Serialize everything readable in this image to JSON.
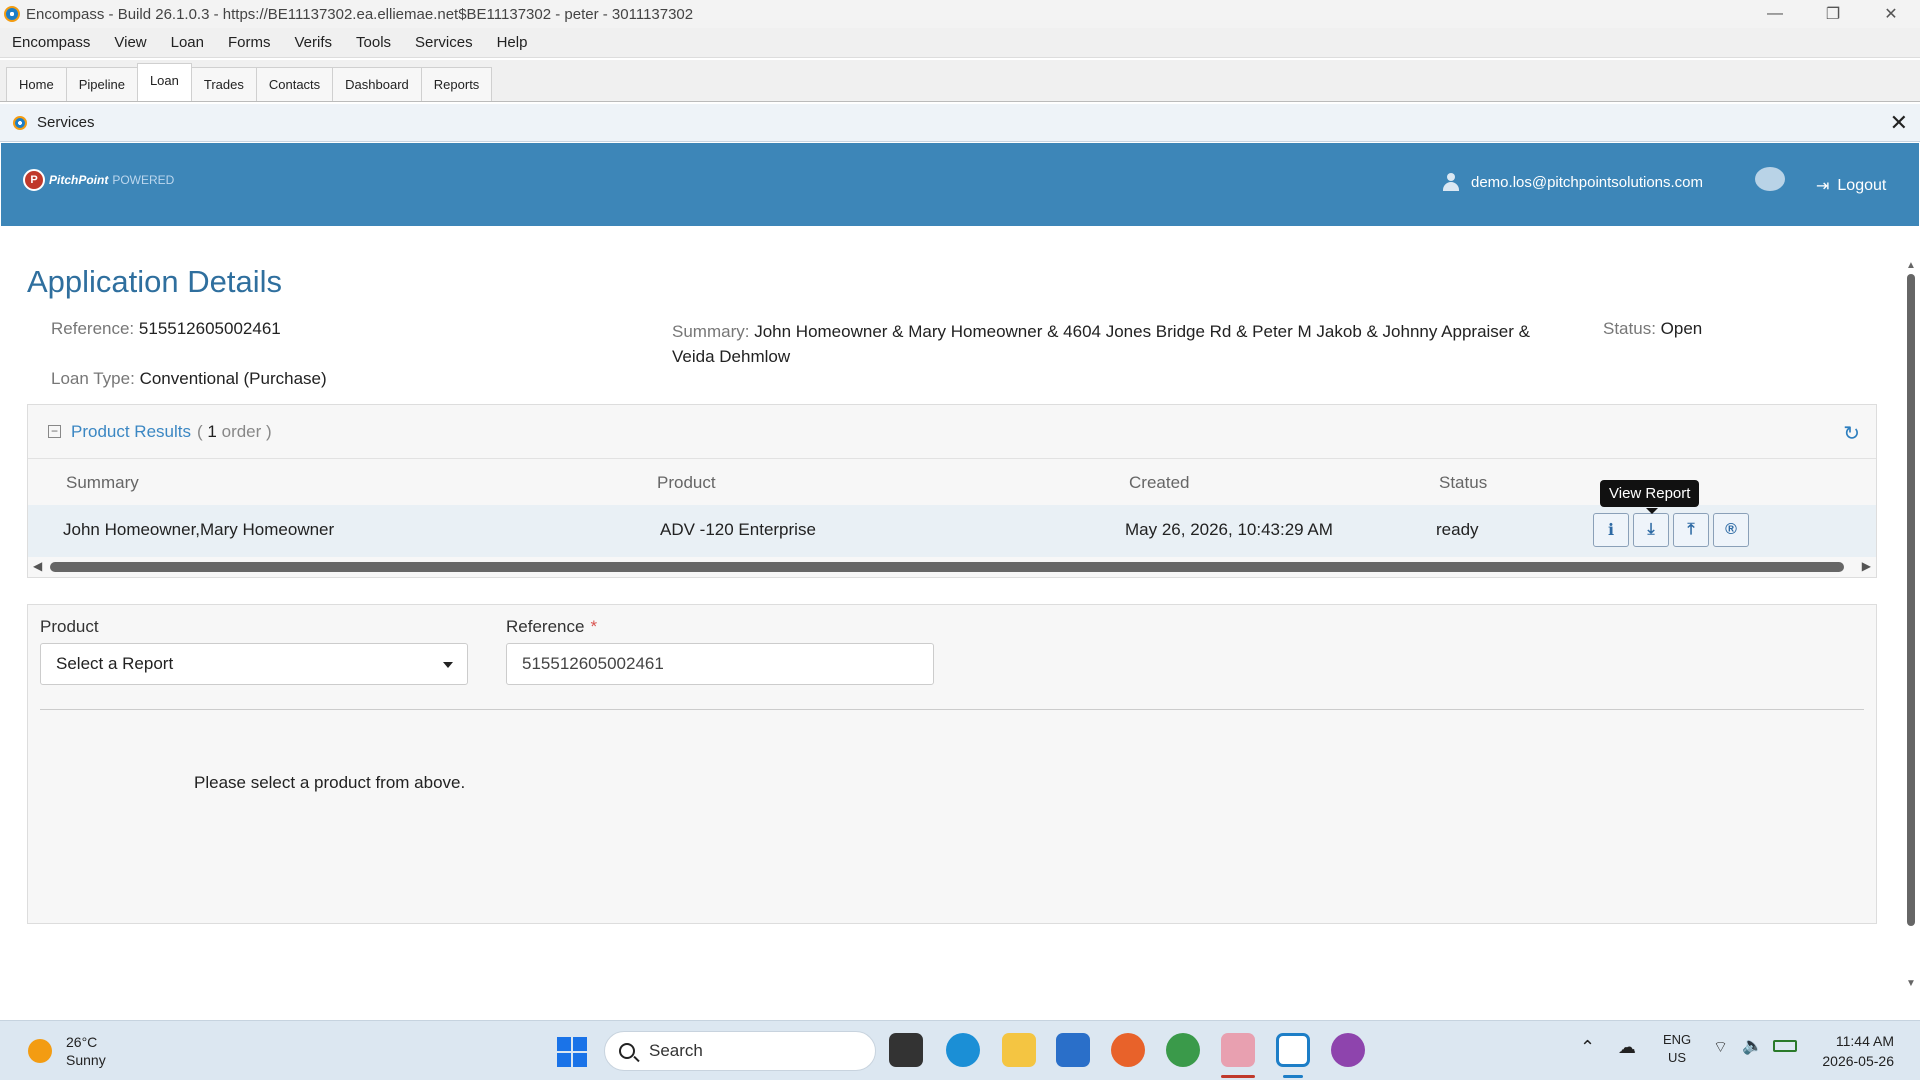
{
  "window": {
    "title": "Encompass - Build 26.1.0.3 - https://BE11137302.ea.elliemae.net$BE11137302 - peter - 3011137302",
    "controls": [
      "—",
      "❐",
      "✕"
    ]
  },
  "menu": [
    "Encompass",
    "View",
    "Loan",
    "Forms",
    "Verifs",
    "Tools",
    "Services",
    "Help"
  ],
  "tabs": [
    {
      "label": "Home",
      "active": false
    },
    {
      "label": "Pipeline",
      "active": false
    },
    {
      "label": "Loan",
      "active": true
    },
    {
      "label": "Trades",
      "active": false
    },
    {
      "label": "Contacts",
      "active": false
    },
    {
      "label": "Dashboard",
      "active": false
    },
    {
      "label": "Reports",
      "active": false
    }
  ],
  "services_panel": {
    "title": "Services",
    "close": "✕"
  },
  "header": {
    "brand": "PitchPoint",
    "powered": "POWERED",
    "user_email": "demo.los@pitchpointsolutions.com",
    "logout": "Logout",
    "accent": "#3d86b8"
  },
  "details": {
    "title": "Application Details",
    "reference_label": "Reference:",
    "reference_value": "515512605002461",
    "loan_type_label": "Loan Type:",
    "loan_type_value": "Conventional (Purchase)",
    "summary_label": "Summary:",
    "summary_line1": "John Homeowner & Mary Homeowner & 4604 Jones Bridge Rd & Peter M Jakob & Johnny Appraiser &",
    "summary_line2": "Veida Dehmlow",
    "status_label": "Status:",
    "status_value": "Open"
  },
  "results": {
    "title": "Product Results",
    "count_open": "(",
    "count_num": "1",
    "count_text": "order )",
    "columns": [
      "Summary",
      "Product",
      "Created",
      "Status"
    ],
    "rows": [
      {
        "summary": "John Homeowner,Mary Homeowner",
        "product": "ADV -120 Enterprise",
        "created": "May 26, 2026, 10:43:29 AM",
        "status": "ready"
      }
    ],
    "actions": [
      {
        "name": "info",
        "glyph": "ℹ"
      },
      {
        "name": "view-report",
        "glyph": "⤓"
      },
      {
        "name": "upload",
        "glyph": "⤒"
      },
      {
        "name": "reorder",
        "glyph": "®"
      }
    ],
    "tooltip": "View Report"
  },
  "order_form": {
    "product_label": "Product",
    "product_selected": "Select a Report",
    "reference_label": "Reference",
    "reference_required": "*",
    "reference_value": "515512605002461",
    "hint": "Please select a product from above."
  },
  "taskbar": {
    "temperature": "26°C",
    "condition": "Sunny",
    "search_placeholder": "Search",
    "lang_top": "ENG",
    "lang_bottom": "US",
    "time": "11:44 AM",
    "date": "2026-05-26"
  }
}
